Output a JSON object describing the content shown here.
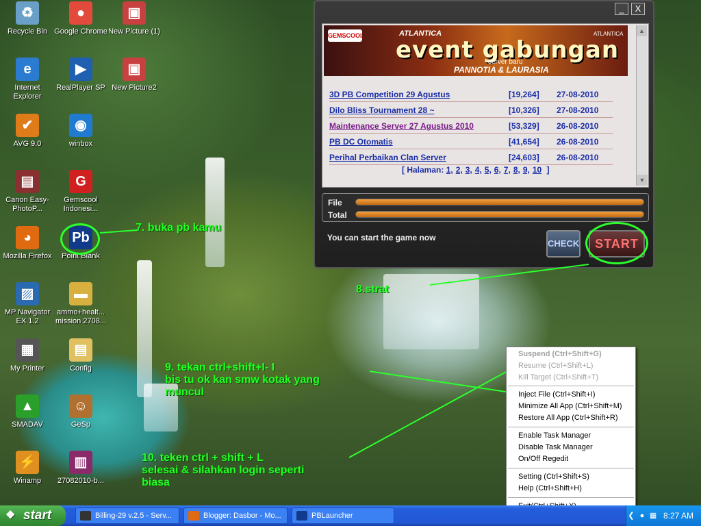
{
  "desktop": {
    "icons": [
      {
        "label": "Recycle Bin",
        "icon": "recycle-bin-icon"
      },
      {
        "label": "Google Chrome",
        "icon": "chrome-icon"
      },
      {
        "label": "New Picture (1)",
        "icon": "picture-file-icon"
      },
      {
        "label": "Internet Explorer",
        "icon": "internet-explorer-icon"
      },
      {
        "label": "RealPlayer SP",
        "icon": "realplayer-icon"
      },
      {
        "label": "New Picture2",
        "icon": "picture-file-icon"
      },
      {
        "label": "AVG 9.0",
        "icon": "avg-icon"
      },
      {
        "label": "winbox",
        "icon": "winbox-icon"
      },
      {
        "label": "Canon Easy-PhotoP...",
        "icon": "canon-printer-icon"
      },
      {
        "label": "Gemscool Indonesi...",
        "icon": "gemscool-icon"
      },
      {
        "label": "Mozilla Firefox",
        "icon": "firefox-icon"
      },
      {
        "label": "Point Blank",
        "icon": "point-blank-icon"
      },
      {
        "label": "MP Navigator EX 1.2",
        "icon": "mp-navigator-icon"
      },
      {
        "label": "ammo+healt... mission 2708...",
        "icon": "folder-icon"
      },
      {
        "label": "My Printer",
        "icon": "printer-icon"
      },
      {
        "label": "Config",
        "icon": "config-file-icon"
      },
      {
        "label": "SMADAV",
        "icon": "smadav-icon"
      },
      {
        "label": "GeSp",
        "icon": "gesp-icon"
      },
      {
        "label": "Winamp",
        "icon": "winamp-icon"
      },
      {
        "label": "27082010-b...",
        "icon": "winrar-archive-icon"
      }
    ]
  },
  "launcher": {
    "minimize": "_",
    "close": "X",
    "banner": {
      "brand": "GEMSCOOL",
      "game": "ATLANTICA",
      "headline": "event gabungan",
      "sub1": "server baru",
      "sub2": "PANNOTIA & LAURASIA",
      "right_logo": "ATLANTICA"
    },
    "news": [
      {
        "title": "3D PB Competition 29 Agustus",
        "count": "[19,264]",
        "date": "27-08-2010"
      },
      {
        "title": "Dilo Bliss Tournament 28 ~",
        "count": "[10,326]",
        "date": "27-08-2010"
      },
      {
        "title": "Maintenance Server 27 Agustus 2010",
        "count": "[53,329]",
        "date": "26-08-2010"
      },
      {
        "title": "PB DC Otomatis",
        "count": "[41,654]",
        "date": "26-08-2010"
      },
      {
        "title": "Perihal Perbaikan Clan Server",
        "count": "[24,603]",
        "date": "26-08-2010"
      }
    ],
    "pagination": {
      "prefix": "[ Halaman:",
      "pages": [
        "1,",
        "2,",
        "3,",
        "4,",
        "5,",
        "6,",
        "7,",
        "8,",
        "9,",
        "10"
      ],
      "suffix": "]"
    },
    "file_label": "File",
    "total_label": "Total",
    "file_progress": 1.0,
    "total_progress": 1.0,
    "status": "You can start the game now",
    "check_label": "CHECK",
    "start_label": "START"
  },
  "annotations": {
    "step7": "7. buka pb kamu",
    "step8": "8.strat",
    "step9": "9. tekan ctrl+shift+I- I\nbis tu ok kan smw kotak yang\nmuncul",
    "step10": "10. teken ctrl + shift + L\nselesai & silahkan login seperti\nbiasa"
  },
  "context_menu": {
    "items": [
      {
        "label": "Suspend (Ctrl+Shift+G)",
        "state": "disabled-bold"
      },
      {
        "label": "Resume (Ctrl+Shift+L)",
        "state": "disabled"
      },
      {
        "label": "Kill Target (Ctrl+Shift+T)",
        "state": "disabled"
      },
      {
        "label": "Inject File (Ctrl+Shift+I)",
        "state": "enabled"
      },
      {
        "label": "Minimize All App (Ctrl+Shift+M)",
        "state": "enabled"
      },
      {
        "label": "Restore All App (Ctrl+Shift+R)",
        "state": "enabled"
      },
      {
        "label": "Enable Task Manager",
        "state": "enabled"
      },
      {
        "label": "Disable Task Manager",
        "state": "enabled"
      },
      {
        "label": "On/Off Regedit",
        "state": "enabled"
      },
      {
        "label": "Setting (Ctrl+Shift+S)",
        "state": "enabled"
      },
      {
        "label": "Help (Ctrl+Shift+H)",
        "state": "enabled"
      },
      {
        "label": "Exit(Ctrl+Shift+X)",
        "state": "enabled"
      }
    ]
  },
  "taskbar": {
    "start_label": "start",
    "items": [
      {
        "label": "Billing-29 v.2.5 - Serv...",
        "icon": "billing-icon"
      },
      {
        "label": "Blogger: Dasbor - Mo...",
        "icon": "firefox-icon"
      },
      {
        "label": "PBLauncher",
        "icon": "point-blank-icon"
      }
    ],
    "clock": "8:27 AM"
  },
  "colors": {
    "annotation_green": "#22ff22",
    "link_blue": "#1a2ea8",
    "maintenance_purple": "#7a1a8a",
    "progress_orange": "#e08a2a",
    "taskbar_blue": "#245edb",
    "start_green": "#3c9a3c"
  }
}
